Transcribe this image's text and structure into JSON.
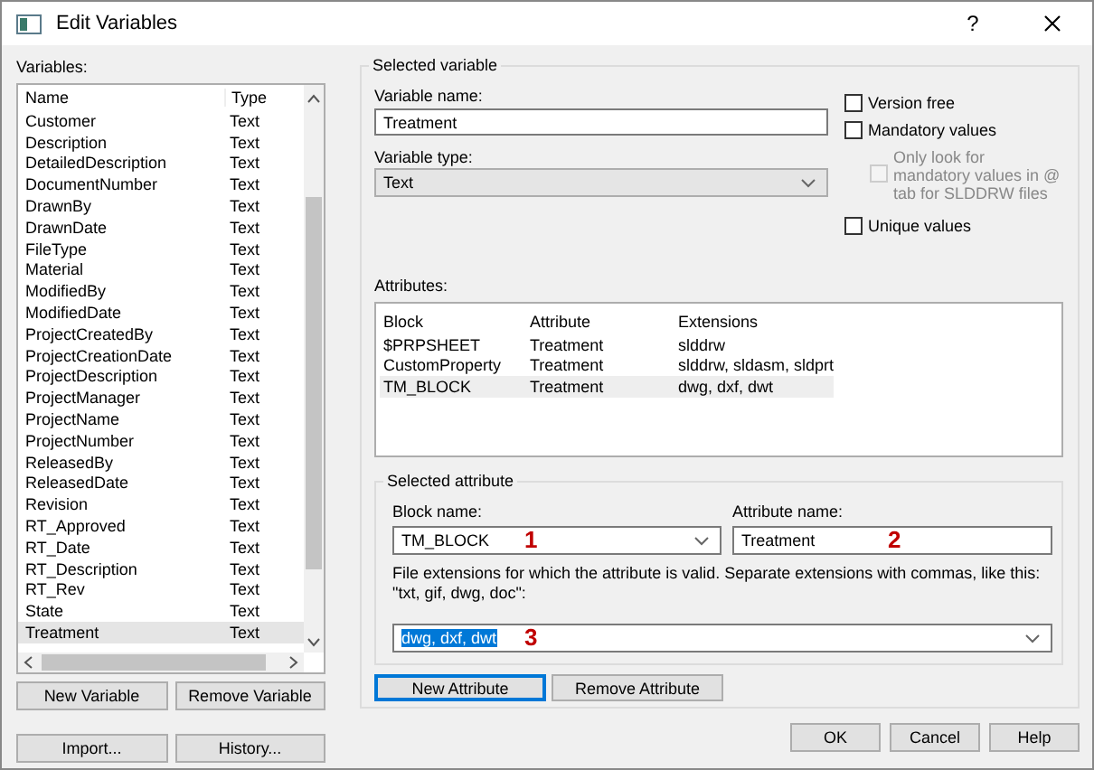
{
  "window": {
    "title": "Edit Variables",
    "help_glyph": "?"
  },
  "variables": {
    "label": "Variables:",
    "columns": [
      "Name",
      "Type"
    ],
    "rows": [
      {
        "name": "Customer",
        "type": "Text",
        "selected": false
      },
      {
        "name": "Description",
        "type": "Text",
        "selected": false
      },
      {
        "name": "DetailedDescription",
        "type": "Text",
        "selected": false
      },
      {
        "name": "DocumentNumber",
        "type": "Text",
        "selected": false
      },
      {
        "name": "DrawnBy",
        "type": "Text",
        "selected": false
      },
      {
        "name": "DrawnDate",
        "type": "Text",
        "selected": false
      },
      {
        "name": "FileType",
        "type": "Text",
        "selected": false
      },
      {
        "name": "Material",
        "type": "Text",
        "selected": false
      },
      {
        "name": "ModifiedBy",
        "type": "Text",
        "selected": false
      },
      {
        "name": "ModifiedDate",
        "type": "Text",
        "selected": false
      },
      {
        "name": "ProjectCreatedBy",
        "type": "Text",
        "selected": false
      },
      {
        "name": "ProjectCreationDate",
        "type": "Text",
        "selected": false
      },
      {
        "name": "ProjectDescription",
        "type": "Text",
        "selected": false
      },
      {
        "name": "ProjectManager",
        "type": "Text",
        "selected": false
      },
      {
        "name": "ProjectName",
        "type": "Text",
        "selected": false
      },
      {
        "name": "ProjectNumber",
        "type": "Text",
        "selected": false
      },
      {
        "name": "ReleasedBy",
        "type": "Text",
        "selected": false
      },
      {
        "name": "ReleasedDate",
        "type": "Text",
        "selected": false
      },
      {
        "name": "Revision",
        "type": "Text",
        "selected": false
      },
      {
        "name": "RT_Approved",
        "type": "Text",
        "selected": false
      },
      {
        "name": "RT_Date",
        "type": "Text",
        "selected": false
      },
      {
        "name": "RT_Description",
        "type": "Text",
        "selected": false
      },
      {
        "name": "RT_Rev",
        "type": "Text",
        "selected": false
      },
      {
        "name": "State",
        "type": "Text",
        "selected": false
      },
      {
        "name": "Treatment",
        "type": "Text",
        "selected": true
      }
    ],
    "buttons": [
      "New Variable",
      "Remove Variable"
    ],
    "bottom_buttons": [
      "Import...",
      "History..."
    ]
  },
  "selected_variable": {
    "title": "Selected variable",
    "name_label": "Variable name:",
    "name_value": "Treatment",
    "type_label": "Variable type:",
    "type_value": "Text",
    "checkboxes": [
      {
        "label": "Version free",
        "checked": false,
        "disabled": false
      },
      {
        "label": "Mandatory values",
        "checked": false,
        "disabled": false
      },
      {
        "label": "Only look for mandatory values in @ tab for SLDDRW files",
        "checked": false,
        "disabled": true
      },
      {
        "label": "Unique values",
        "checked": false,
        "disabled": false
      }
    ],
    "attributes_label": "Attributes:",
    "attribute_columns": [
      "Block",
      "Attribute",
      "Extensions"
    ],
    "attributes": [
      {
        "block": "$PRPSHEET",
        "attribute": "Treatment",
        "extensions": "slddrw",
        "selected": false
      },
      {
        "block": "CustomProperty",
        "attribute": "Treatment",
        "extensions": "slddrw, sldasm, sldprt",
        "selected": false
      },
      {
        "block": "TM_BLOCK",
        "attribute": "Treatment",
        "extensions": "dwg, dxf, dwt",
        "selected": true
      }
    ]
  },
  "selected_attribute": {
    "title": "Selected attribute",
    "block_label": "Block name:",
    "block_value": "TM_BLOCK",
    "attr_label": "Attribute name:",
    "attr_value": "Treatment",
    "ext_hint": "File extensions for which the attribute is valid. Separate extensions with commas, like this: \"txt, gif, dwg, doc\":",
    "ext_value": "dwg, dxf, dwt",
    "ext_highlighted": true,
    "buttons": [
      {
        "label": "New Attribute",
        "focused": true
      },
      {
        "label": "Remove Attribute",
        "focused": false
      }
    ]
  },
  "annotations": [
    "1",
    "2",
    "3"
  ],
  "dialog_buttons": [
    "OK",
    "Cancel",
    "Help"
  ]
}
